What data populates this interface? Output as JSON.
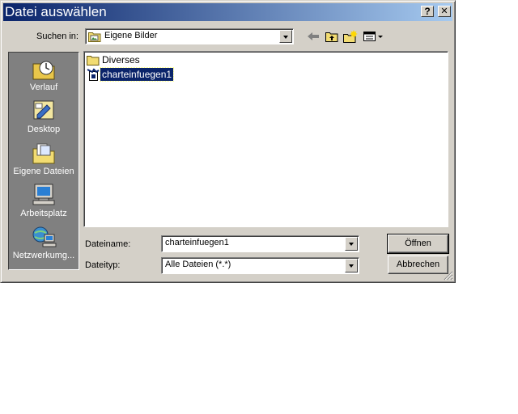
{
  "window": {
    "title": "Datei auswählen",
    "help_button": "?",
    "close_button": "✕"
  },
  "look_in": {
    "label": "Suchen in:",
    "value": "Eigene Bilder"
  },
  "places": [
    {
      "label": "Verlauf",
      "icon": "history-icon"
    },
    {
      "label": "Desktop",
      "icon": "desktop-icon"
    },
    {
      "label": "Eigene Dateien",
      "icon": "my-documents-icon"
    },
    {
      "label": "Arbeitsplatz",
      "icon": "my-computer-icon"
    },
    {
      "label": "Netzwerkumg...",
      "icon": "network-icon"
    }
  ],
  "files": [
    {
      "name": "Diverses",
      "icon": "folder-icon",
      "selected": false
    },
    {
      "name": "charteinfuegen1",
      "icon": "file-icon",
      "selected": true
    }
  ],
  "filename": {
    "label": "Dateiname:",
    "value": "charteinfuegen1"
  },
  "filetype": {
    "label": "Dateityp:",
    "value": "Alle Dateien (*.*)"
  },
  "buttons": {
    "open": "Öffnen",
    "cancel": "Abbrechen"
  }
}
